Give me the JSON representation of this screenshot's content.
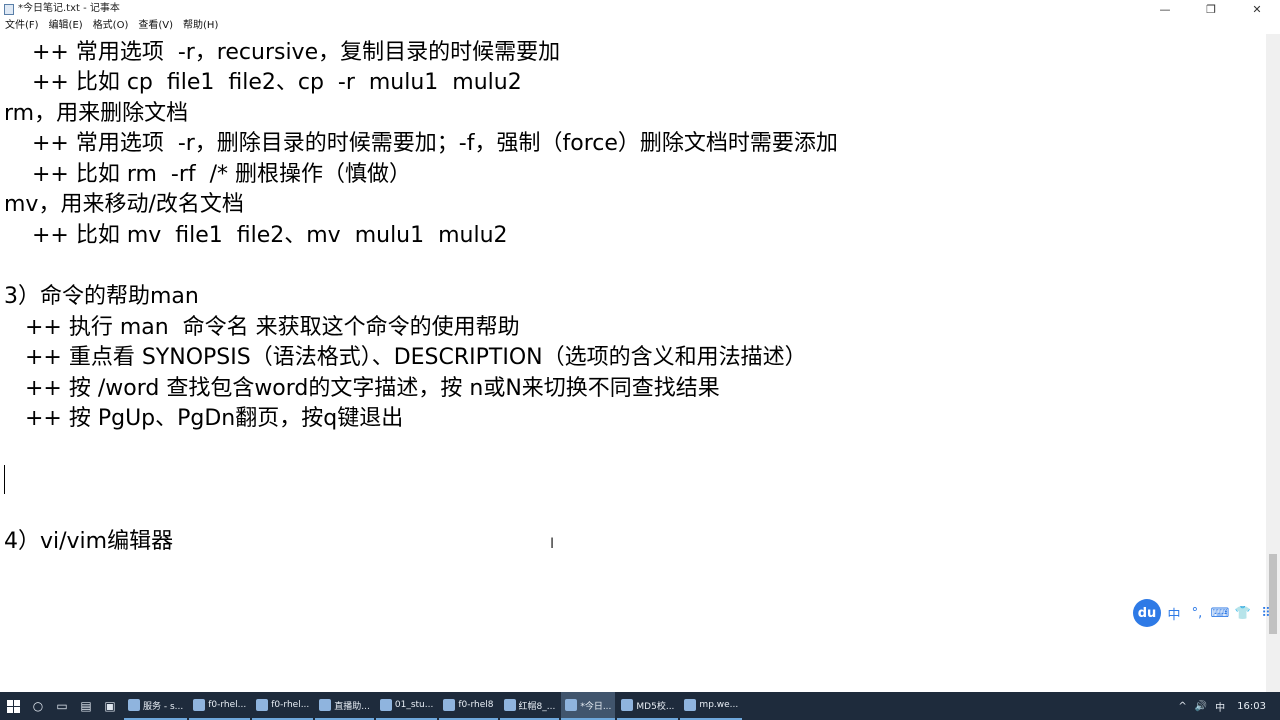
{
  "window": {
    "title": "*今日笔记.txt - 记事本",
    "minimize_icon": "—",
    "maximize_icon": "❐",
    "close_icon": "✕"
  },
  "menu": [
    {
      "label": "文件(F)"
    },
    {
      "label": "编辑(E)"
    },
    {
      "label": "格式(O)"
    },
    {
      "label": "查看(V)"
    },
    {
      "label": "帮助(H)"
    }
  ],
  "content": {
    "lines": [
      "    ++ 常用选项  -r，recursive，复制目录的时候需要加",
      "    ++ 比如 cp  file1  file2、cp  -r  mulu1  mulu2",
      "rm，用来删除文档",
      "    ++ 常用选项  -r，删除目录的时候需要加；-f，强制（force）删除文档时需要添加",
      "    ++ 比如 rm  -rf  /* 删根操作（慎做）",
      "mv，用来移动/改名文档",
      "    ++ 比如 mv  file1  file2、mv  mulu1  mulu2",
      "",
      "3）命令的帮助man",
      "   ++ 执行 man  命令名 来获取这个命令的使用帮助",
      "   ++ 重点看 SYNOPSIS（语法格式）、DESCRIPTION（选项的含义和用法描述）",
      "   ++ 按 /word 查找包含word的文字描述，按 n或N来切换不同查找结果",
      "   ++ 按 PgUp、PgDn翻页，按q键退出",
      "",
      "",
      "",
      "4）vi/vim编辑器"
    ]
  },
  "ime": {
    "logo": "du",
    "tools": [
      "中",
      "°,",
      "⌨",
      "👕",
      "⠿"
    ]
  },
  "taskbar": {
    "tasks": [
      {
        "label": "服务 - s..."
      },
      {
        "label": "f0-rhel..."
      },
      {
        "label": "f0-rhel..."
      },
      {
        "label": "直播助..."
      },
      {
        "label": "01_stu..."
      },
      {
        "label": "f0-rhel8"
      },
      {
        "label": "红帽8_..."
      },
      {
        "label": "*今日..."
      },
      {
        "label": "MD5校..."
      },
      {
        "label": "mp.we..."
      }
    ],
    "tray": [
      "^",
      "🔊",
      "中"
    ],
    "clock": "16:03"
  }
}
